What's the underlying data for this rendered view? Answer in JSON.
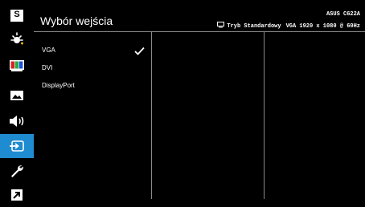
{
  "sidebar": {
    "items": [
      {
        "id": "splendid",
        "icon": "splendid-s-icon",
        "label": "S"
      },
      {
        "id": "blue-light",
        "icon": "blue-light-filter-icon"
      },
      {
        "id": "color",
        "icon": "color-bars-icon"
      },
      {
        "id": "image",
        "icon": "image-icon"
      },
      {
        "id": "sound",
        "icon": "speaker-icon"
      },
      {
        "id": "input-select",
        "icon": "input-select-icon",
        "selected": true
      },
      {
        "id": "system-setup",
        "icon": "wrench-icon"
      },
      {
        "id": "shortcut",
        "icon": "shortcut-arrow-icon"
      }
    ]
  },
  "header": {
    "title": "Wybór wejścia",
    "model": "ASUS C622A",
    "mode": "Tryb Standardowy",
    "signal": "VGA 1920 x 1080 @ 60Hz"
  },
  "inputs": [
    {
      "label": "VGA",
      "checked": true
    },
    {
      "label": "DVI",
      "checked": false
    },
    {
      "label": "DisplayPort",
      "checked": false
    }
  ],
  "colors": {
    "accent": "#1f8bd0",
    "background": "#000000",
    "divider": "#8a8a8a"
  }
}
